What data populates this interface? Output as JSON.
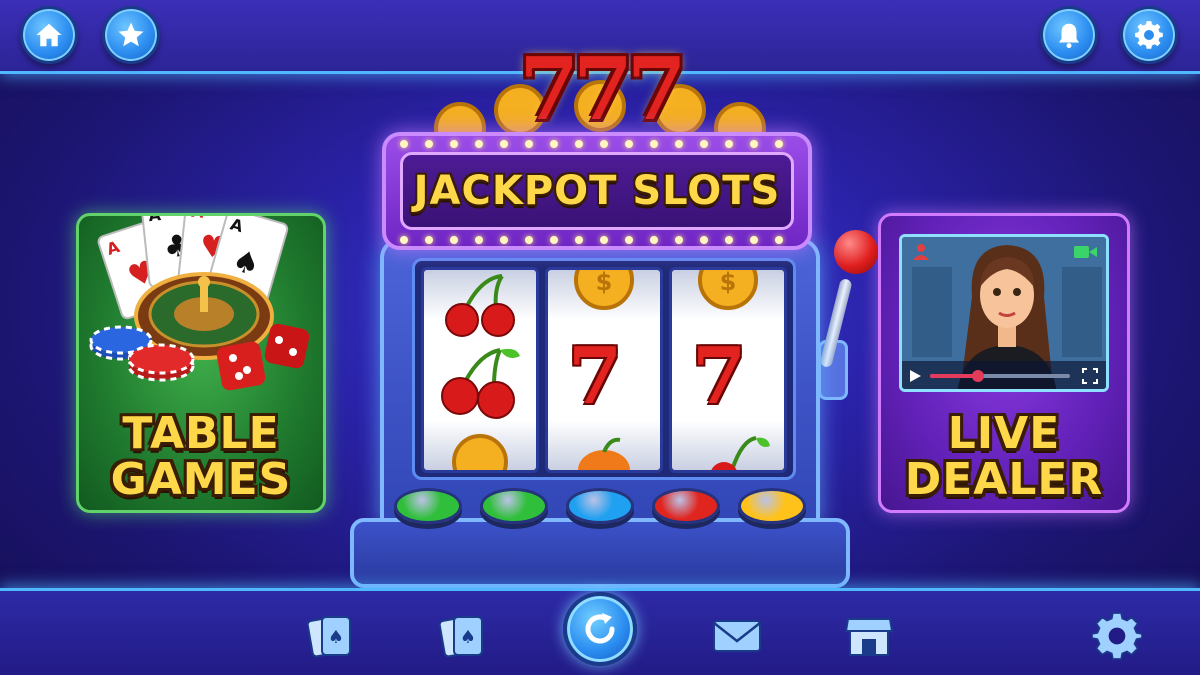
{
  "top_bar": {
    "icons": [
      "home-icon",
      "star-icon",
      "bell-icon",
      "gear-icon"
    ]
  },
  "panels": {
    "table_games": {
      "title_line1": "TABLE",
      "title_line2": "GAMES"
    },
    "live_dealer": {
      "title_line1": "LIVE",
      "title_line2": "DEALER"
    }
  },
  "slot_machine": {
    "title": "JACKPOT SLOTS",
    "topper": "777",
    "reels": [
      [
        "cherry",
        "cherry",
        "coin"
      ],
      [
        "coin",
        "7",
        "fruit"
      ],
      [
        "coin",
        "7",
        "cherry"
      ]
    ],
    "reel_center_text": [
      "7",
      "7"
    ],
    "buttons": [
      {
        "color": "#2fbf3a"
      },
      {
        "color": "#2fbf3a"
      },
      {
        "color": "#1fa0f0"
      },
      {
        "color": "#e0241e"
      },
      {
        "color": "#ffc21a"
      }
    ]
  },
  "bottom_bar": {
    "icons": [
      "cards-icon",
      "card-spade-icon",
      "refresh-icon",
      "mail-icon",
      "shop-icon",
      "gear-icon"
    ]
  },
  "colors": {
    "accent_gold": "#ffd84a",
    "glow_blue": "#4fb8ff",
    "table_green": "#1f7a2e",
    "live_purple": "#6221b8"
  }
}
